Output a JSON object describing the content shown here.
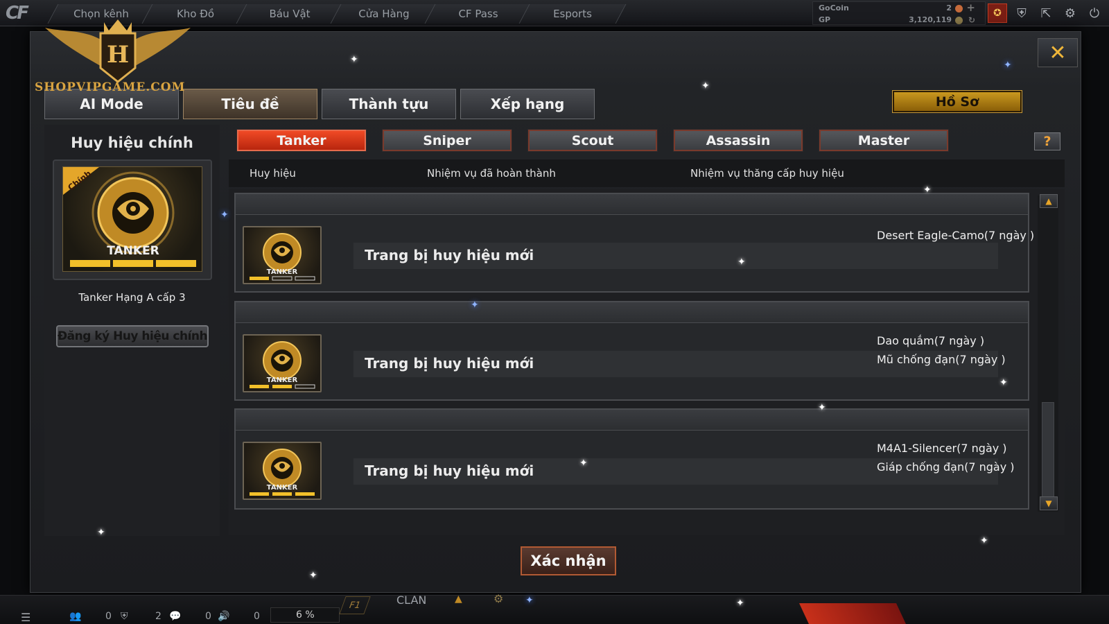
{
  "topbar": {
    "logo": "CF",
    "tabs": [
      "Chọn kênh",
      "Kho Đồ",
      "Báu Vật",
      "Cửa Hàng",
      "CF Pass",
      "Esports"
    ],
    "currency": {
      "gocoin_label": "GoCoin",
      "gocoin_value": "2",
      "gp_label": "GP",
      "gp_value": "3,120,119"
    }
  },
  "watermark": {
    "text": "SHOPVIPGAME.COM",
    "monogram": "H"
  },
  "modal": {
    "close_label": "✕",
    "tabs": [
      "AI Mode",
      "Tiêu đề",
      "Thành tựu",
      "Xếp hạng"
    ],
    "active_tab": "Tiêu đề",
    "profile_button": "Hồ Sơ",
    "left": {
      "title": "Huy hiệu chính",
      "corner_tag": "Chính",
      "badge_label": "TANKER",
      "caption": "Tanker Hạng A cấp 3",
      "register_button": "Đăng ký Huy hiệu chính"
    },
    "class_tabs": [
      "Tanker",
      "Sniper",
      "Scout",
      "Assassin",
      "Master"
    ],
    "active_class": "Tanker",
    "help_label": "?",
    "columns": [
      "Huy hiệu",
      "Nhiệm vụ đã hoàn thành",
      "Nhiệm vụ thăng cấp huy hiệu"
    ],
    "rows": [
      {
        "badge_label": "TANKER",
        "progress_filled": 1,
        "progress_total": 3,
        "mission": "Trang bị huy hiệu mới",
        "rewards": [
          "Desert Eagle-Camo(7 ngày )"
        ]
      },
      {
        "badge_label": "TANKER",
        "progress_filled": 2,
        "progress_total": 3,
        "mission": "Trang bị huy hiệu mới",
        "rewards": [
          "Dao quắm(7 ngày )",
          "Mũ chống đạn(7 ngày )"
        ]
      },
      {
        "badge_label": "TANKER",
        "progress_filled": 3,
        "progress_total": 3,
        "mission": "Trang bị huy hiệu mới",
        "rewards": [
          "M4A1-Silencer(7 ngày )",
          "Giáp chống đạn(7 ngày )"
        ]
      }
    ],
    "confirm_button": "Xác nhận"
  },
  "bottombar": {
    "counts": [
      "0",
      "2",
      "0",
      "0"
    ],
    "progress_text": "6 %",
    "f1_label": "F1",
    "clan_label": "CLAN"
  },
  "colors": {
    "accent_red": "#e0401f",
    "gold": "#d9a441",
    "panel": "#1f2023"
  }
}
